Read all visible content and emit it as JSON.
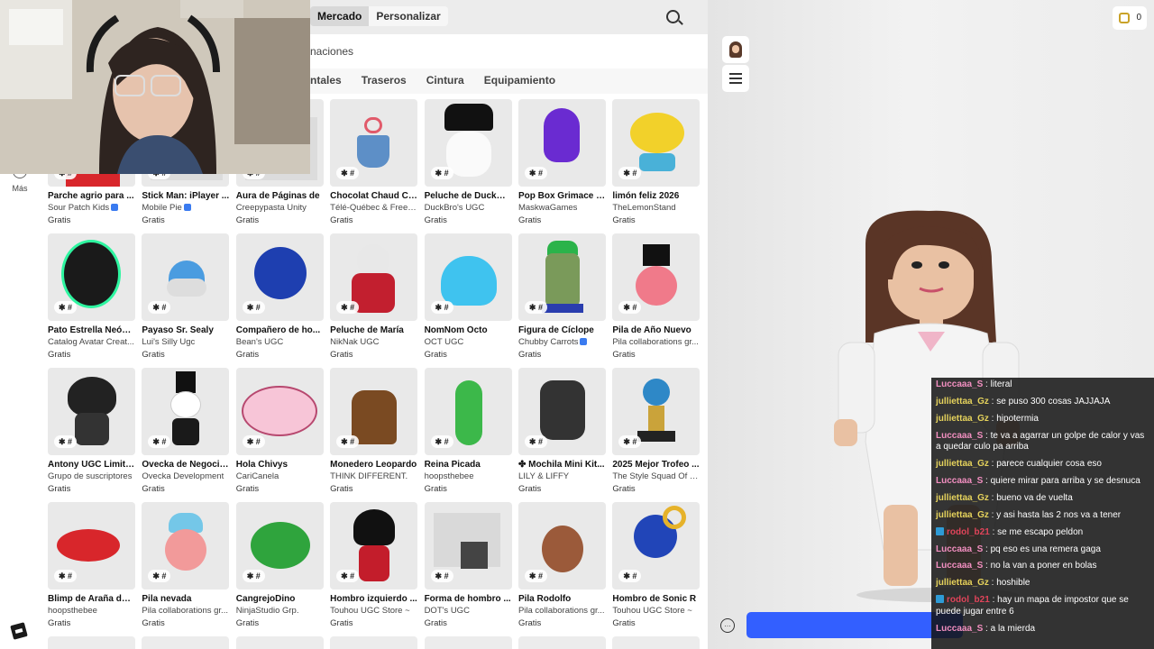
{
  "header": {
    "tab_market": "Mercado",
    "tab_customize": "Personalizar",
    "section_partial": "naciones"
  },
  "category_tabs": [
    "ntales",
    "Traseros",
    "Cintura",
    "Equipamiento"
  ],
  "sidebar": {
    "more_label": "Más"
  },
  "items": [
    {
      "name": "Parche agrio para ...",
      "creator": "Sour Patch Kids",
      "verified": true,
      "price": "Gratis",
      "art": "red"
    },
    {
      "name": "Stick Man: iPlayer ...",
      "creator": "Mobile Pie",
      "verified": true,
      "price": "Gratis",
      "art": "gray"
    },
    {
      "name": "Aura de Páginas de",
      "creator": "Creepypasta Unity",
      "verified": false,
      "price": "Gratis",
      "art": "gray"
    },
    {
      "name": "Chocolat Chaud Ci...",
      "creator": "Télé-Québec & Freeg...",
      "verified": false,
      "price": "Gratis",
      "art": "cup"
    },
    {
      "name": "Peluche de DuckBro",
      "creator": "DuckBro's UGC",
      "verified": false,
      "price": "Gratis",
      "art": "hat"
    },
    {
      "name": "Pop Box Grimace M...",
      "creator": "MaskwaGames",
      "verified": false,
      "price": "Gratis",
      "art": "purple"
    },
    {
      "name": "limón feliz 2026",
      "creator": "TheLemonStand",
      "verified": false,
      "price": "Gratis",
      "art": "lemon"
    },
    {
      "name": "Pato Estrella Neón ...",
      "creator": "Catalog Avatar Creat...",
      "verified": false,
      "price": "Gratis",
      "art": "duck"
    },
    {
      "name": "Payaso Sr. Sealy",
      "creator": "Lui's Silly Ugc",
      "verified": false,
      "price": "Gratis",
      "art": "seal"
    },
    {
      "name": "Compañero de ho...",
      "creator": "Bean's UGC",
      "verified": false,
      "price": "Gratis",
      "art": "blueball"
    },
    {
      "name": "Peluche de María",
      "creator": "NikNak UGC",
      "verified": false,
      "price": "Gratis",
      "art": "maria"
    },
    {
      "name": "NomNom Octo",
      "creator": "OCT UGC",
      "verified": false,
      "price": "Gratis",
      "art": "octo"
    },
    {
      "name": "Figura de Cíclope",
      "creator": "Chubby Carrots",
      "verified": true,
      "price": "Gratis",
      "art": "cyclops"
    },
    {
      "name": "Pila de Año Nuevo",
      "creator": "Pila collaborations gr...",
      "verified": false,
      "price": "Gratis",
      "art": "tophat"
    },
    {
      "name": "Antony UGC Limite...",
      "creator": "Grupo de suscriptores",
      "verified": false,
      "price": "Gratis",
      "art": "antony"
    },
    {
      "name": "Ovecka de Negocio...",
      "creator": "Ovecka Development",
      "verified": false,
      "price": "Gratis",
      "art": "ovecka"
    },
    {
      "name": "Hola Chivys",
      "creator": "CariCanela",
      "verified": false,
      "price": "Gratis",
      "art": "chivys"
    },
    {
      "name": "Monedero Leopardo",
      "creator": "THINK DIFFERENT.",
      "verified": false,
      "price": "Gratis",
      "art": "purse"
    },
    {
      "name": "Reina Picada",
      "creator": "hoopsthebee",
      "verified": false,
      "price": "Gratis",
      "art": "pickle"
    },
    {
      "name": "Mochila Mini Kit...",
      "creator": "LILY & LIFFY",
      "verified": false,
      "price": "Gratis",
      "art": "backpack",
      "prefix": "✤ "
    },
    {
      "name": "2025 Mejor Trofeo ...",
      "creator": "The Style Squad Of R...",
      "verified": false,
      "price": "Gratis",
      "art": "trophy"
    },
    {
      "name": "Blimp de Araña de ...",
      "creator": "hoopsthebee",
      "verified": false,
      "price": "Gratis",
      "art": "blimp"
    },
    {
      "name": "Pila nevada",
      "creator": "Pila collaborations gr...",
      "verified": false,
      "price": "Gratis",
      "art": "snowpila"
    },
    {
      "name": "CangrejoDino",
      "creator": "NinjaStudio Grp.",
      "verified": false,
      "price": "Gratis",
      "art": "crab"
    },
    {
      "name": "Hombro izquierdo ...",
      "creator": "Touhou UGC Store ~",
      "verified": false,
      "price": "Gratis",
      "art": "shadow"
    },
    {
      "name": "Forma de hombro ...",
      "creator": "DOT's UGC",
      "verified": false,
      "price": "Gratis",
      "art": "block"
    },
    {
      "name": "Pila Rodolfo",
      "creator": "Pila collaborations gr...",
      "verified": false,
      "price": "Gratis",
      "art": "reindeer"
    },
    {
      "name": "Hombro de Sonic R",
      "creator": "Touhou UGC Store ~",
      "verified": false,
      "price": "Gratis",
      "art": "sonic"
    }
  ],
  "item_tag": "✱ #",
  "robux": {
    "balance": "0"
  },
  "chat": [
    {
      "user": "Luccaaa_S",
      "text": ": literal",
      "color": "#f28fc0",
      "badge": false
    },
    {
      "user": "julliettaa_Gz",
      "text": ": se puso 300 cosas JAJJAJA",
      "color": "#e6d35c",
      "badge": false
    },
    {
      "user": "julliettaa_Gz",
      "text": ": hipotermia",
      "color": "#e6d35c",
      "badge": false
    },
    {
      "user": "Luccaaa_S",
      "text": ": te va a agarrar un golpe de calor y vas a quedar culo pa arriba",
      "color": "#f28fc0",
      "badge": false
    },
    {
      "user": "julliettaa_Gz",
      "text": ": parece cualquier cosa eso",
      "color": "#e6d35c",
      "badge": false
    },
    {
      "user": "Luccaaa_S",
      "text": ": quiere mirar para arriba y se desnuca",
      "color": "#f28fc0",
      "badge": false
    },
    {
      "user": "julliettaa_Gz",
      "text": ": bueno va de vuelta",
      "color": "#e6d35c",
      "badge": false
    },
    {
      "user": "julliettaa_Gz",
      "text": ": y asi hasta las 2 nos va a tener",
      "color": "#e6d35c",
      "badge": false
    },
    {
      "user": "rodol_b21",
      "text": ": se me escapo peldon",
      "color": "#e0445a",
      "badge": true
    },
    {
      "user": "Luccaaa_S",
      "text": ": pq eso es una remera gaga",
      "color": "#f28fc0",
      "badge": false
    },
    {
      "user": "Luccaaa_S",
      "text": ": no la van a poner en bolas",
      "color": "#f28fc0",
      "badge": false
    },
    {
      "user": "julliettaa_Gz",
      "text": ": hoshible",
      "color": "#e6d35c",
      "badge": false
    },
    {
      "user": "rodol_b21",
      "text": ": hay un mapa de impostor que se puede jugar entre 6",
      "color": "#e0445a",
      "badge": true
    },
    {
      "user": "Luccaaa_S",
      "text": ": a la mierda",
      "color": "#f28fc0",
      "badge": false
    }
  ]
}
